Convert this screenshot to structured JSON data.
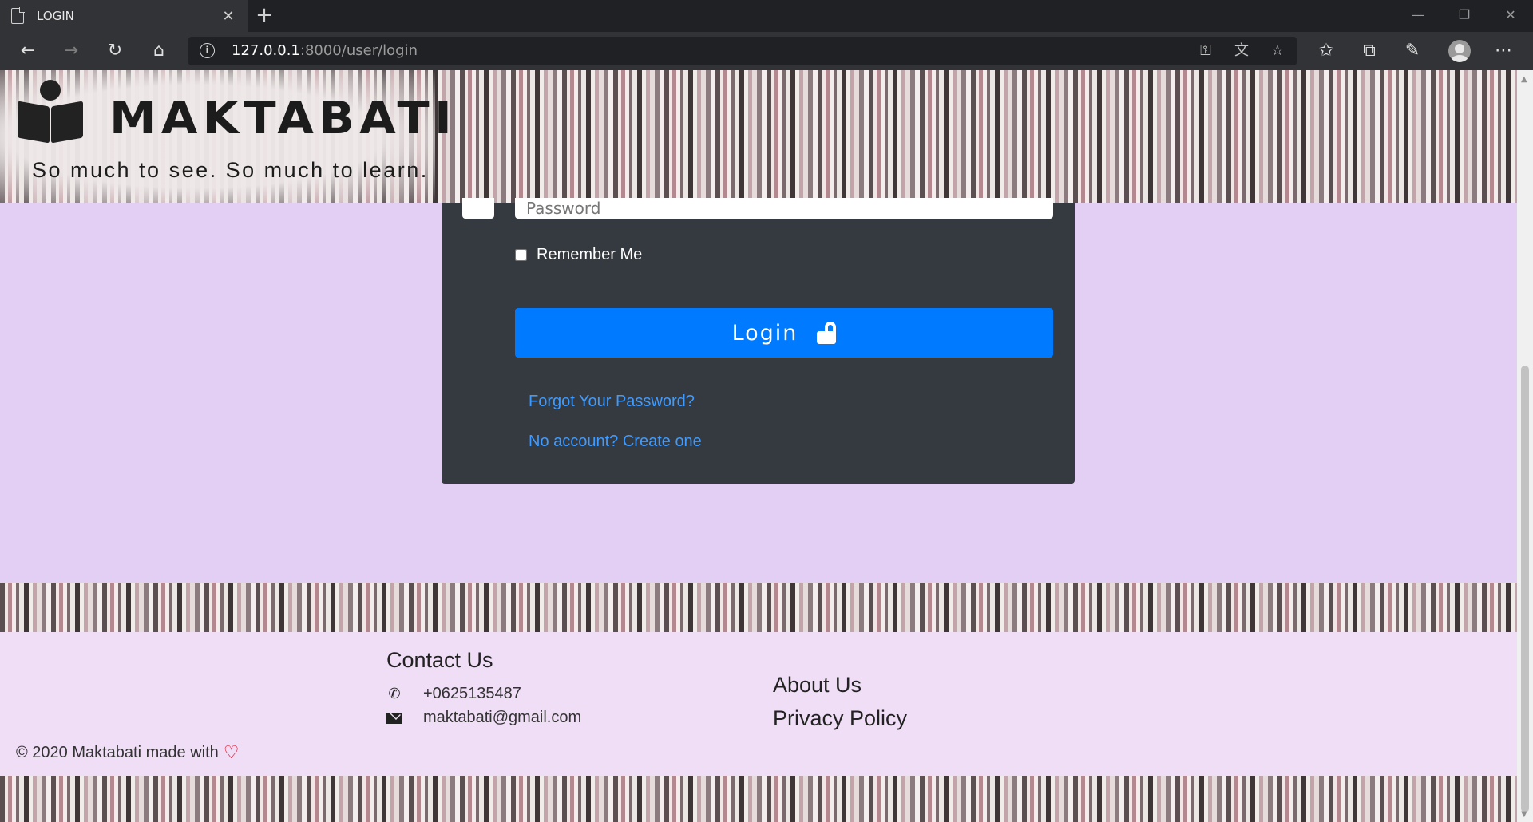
{
  "browser": {
    "tab_title": "LOGIN",
    "tab_close": "✕",
    "new_tab": "+",
    "url_host": "127.0.0.1",
    "url_path": ":8000/user/login",
    "controls": {
      "minimize": "—",
      "restore": "❐",
      "close": "✕"
    }
  },
  "header": {
    "brand": "MAKTABATI",
    "tagline": "So much to see. So much to learn."
  },
  "login_form": {
    "password_placeholder": "Password",
    "remember_label": "Remember Me",
    "login_button": "Login",
    "forgot_link": "Forgot Your Password?",
    "register_link": "No account? Create one",
    "button_color": "#007bff",
    "card_color": "#343a40"
  },
  "footer": {
    "contact_title": "Contact Us",
    "phone": "+0625135487",
    "email": "maktabati@gmail.com",
    "about_link": "About Us",
    "privacy_link": "Privacy Policy",
    "copyright": "© 2020 Maktabati made with",
    "heart_icon": "heart-icon",
    "background": "#f0def7"
  },
  "page_background": "#e2cff3"
}
